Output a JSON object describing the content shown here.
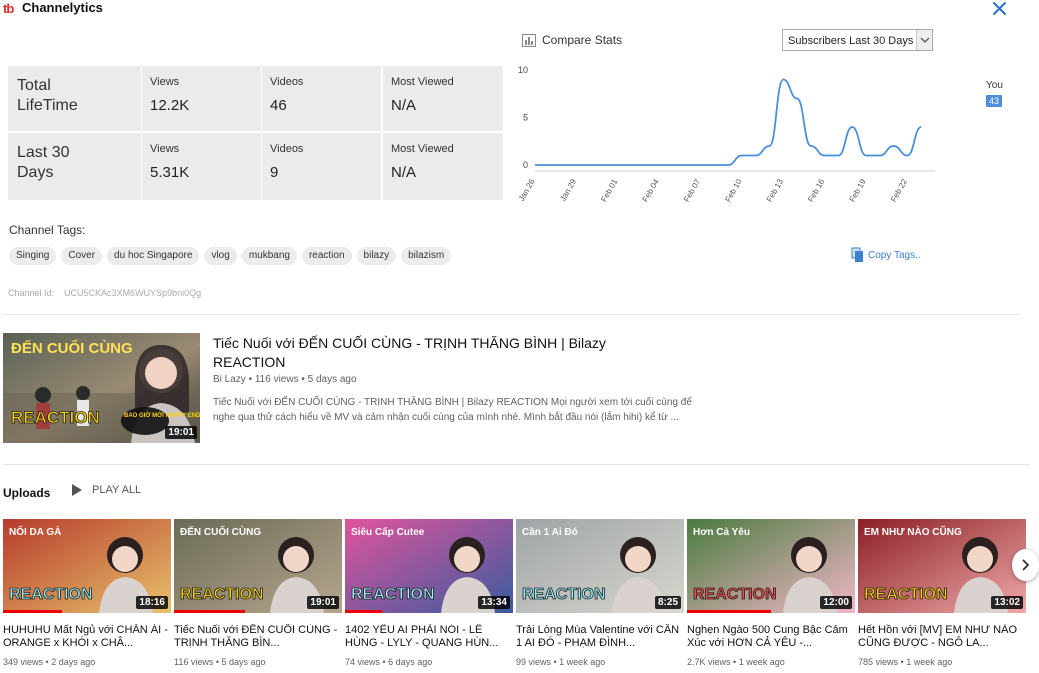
{
  "app": {
    "logo": "tb",
    "title": "Channelytics"
  },
  "stats": {
    "lifetime_label": "Total LifeTime",
    "last30_label": "Last 30 Days",
    "views_label": "Views",
    "videos_label": "Videos",
    "most_viewed_label": "Most Viewed",
    "lifetime": {
      "views": "12.2K",
      "videos": "46",
      "most_viewed": "N/A"
    },
    "last30": {
      "views": "5.31K",
      "videos": "9",
      "most_viewed": "N/A"
    }
  },
  "compare": {
    "title": "Compare Stats",
    "select_value": "Subscribers Last 30 Days",
    "you_label": "You",
    "you_value": "43"
  },
  "chart_data": {
    "type": "line",
    "x": [
      "Jan 26",
      "Jan 27",
      "Jan 28",
      "Jan 29",
      "Jan 30",
      "Jan 31",
      "Feb 01",
      "Feb 02",
      "Feb 03",
      "Feb 04",
      "Feb 05",
      "Feb 06",
      "Feb 07",
      "Feb 08",
      "Feb 09",
      "Feb 10",
      "Feb 11",
      "Feb 12",
      "Feb 13",
      "Feb 14",
      "Feb 15",
      "Feb 16",
      "Feb 17",
      "Feb 18",
      "Feb 19",
      "Feb 20",
      "Feb 21",
      "Feb 22",
      "Feb 23",
      "Feb 24"
    ],
    "series": [
      {
        "name": "You",
        "color": "#4a8fd8",
        "values": [
          0,
          0,
          0,
          0,
          0,
          0,
          0,
          0,
          0,
          0,
          0,
          0,
          0,
          0,
          0,
          1,
          1,
          2,
          9,
          7,
          2,
          1,
          1,
          4,
          1,
          1,
          2,
          1,
          4,
          0
        ]
      }
    ],
    "trimmed_to": "Feb 23",
    "ylim": [
      0,
      10
    ],
    "yticks": [
      0,
      5,
      10
    ],
    "xtick_labels": [
      "Jan 26",
      "Jan 29",
      "Feb 01",
      "Feb 04",
      "Feb 07",
      "Feb 10",
      "Feb 13",
      "Feb 16",
      "Feb 19",
      "Feb 22"
    ],
    "grid": false
  },
  "tags": {
    "title": "Channel Tags:",
    "items": [
      "Singing",
      "Cover",
      "du hoc Singapore",
      "vlog",
      "mukbang",
      "reaction",
      "bilazy",
      "bilazism"
    ],
    "copy_label": "Copy Tags.."
  },
  "channel": {
    "id_label": "Channel Id:",
    "id": "UCU5CKAc3XM6WUYSp9bni0Qg"
  },
  "featured": {
    "title": "Tiếc Nuối với ĐẾN CUỐI CÙNG - TRỊNH THĂNG BÌNH | Bilazy REACTION",
    "meta": "Bi Lazy • 116 views • 5 days ago",
    "description": "Tiếc Nuối với ĐẾN CUỐI CÙNG - TRỊNH THĂNG BÌNH | Bilazy REACTION Mọi người xem tới cuối cùng để nghe qua thử cách hiểu về MV và cảm nhận cuối cùng của mình nhé. Mình bắt đầu nói (lắm hihi) kể từ ...",
    "duration": "19:01",
    "thumb_title": "ĐẾN CUỐI CÙNG",
    "thumb_caption": "BAO GIỜ MỚI HAPPY ENDING ĐƯỢC VẬY???",
    "thumb_word": "REACTION"
  },
  "uploads": {
    "title": "Uploads",
    "play_all": "PLAY ALL",
    "videos": [
      {
        "title": "HUHUHU Mất Ngủ với CHĂN ÁI - ORANGE x KHÓI x CHÂ...",
        "views": "349 views",
        "age": "2 days ago",
        "duration": "18:16",
        "progress": 0.35,
        "bg1": "#b73b2c",
        "bg2": "#e7c16b",
        "word": "REACTION",
        "sub": "NỐI DA GÀ",
        "word_color": "#8ef3ff"
      },
      {
        "title": "Tiếc Nuối với ĐẾN CUỐI CÙNG - TRỊNH THĂNG BÌN...",
        "views": "116 views",
        "age": "5 days ago",
        "duration": "19:01",
        "progress": 0.42,
        "bg1": "#6a6b57",
        "bg2": "#b7a68e",
        "word": "REACTION",
        "sub": "ĐẾN CUỐI CÙNG",
        "word_color": "#ffd400"
      },
      {
        "title": "1402 YÊU AI PHẢI NÓI - LÊ HÙNG - LYLY - QUANG HÙN...",
        "views": "74 views",
        "age": "6 days ago",
        "duration": "13:34",
        "progress": 0.22,
        "bg1": "#e0549d",
        "bg2": "#3a5b9e",
        "word": "REACTION",
        "sub": "Siêu Cấp Cutee",
        "word_color": "#9df7ff"
      },
      {
        "title": "Trải Lòng Mùa Valentine với CẦN 1 AI ĐÓ - PHẠM ĐÌNH...",
        "views": "99 views",
        "age": "1 week ago",
        "duration": "8:25",
        "progress": 0,
        "bg1": "#9ea4a6",
        "bg2": "#d8d7cf",
        "word": "REACTION",
        "sub": "Cần 1 Ai Đó",
        "word_color": "#8ef3ff"
      },
      {
        "title": "Nghẹn Ngào 500 Cung Bậc Cảm Xúc với HƠN CẢ YÊU -...",
        "views": "2.7K views",
        "age": "1 week ago",
        "duration": "12:00",
        "progress": 0.5,
        "bg1": "#4a7b3f",
        "bg2": "#f1b7c8",
        "word": "REACTION",
        "sub": "Hơn Cả Yêu",
        "word_color": "#ff4a4a"
      },
      {
        "title": "Hết Hồn với [MV] EM NHƯ NÀO CŨNG ĐƯỢC - NGÔ LA...",
        "views": "785 views",
        "age": "1 week ago",
        "duration": "13:02",
        "progress": 0,
        "bg1": "#8b1f24",
        "bg2": "#f0a9a9",
        "word": "REACTION",
        "sub": "EM NHƯ NÀO CŨNG",
        "word_color": "#ffd400"
      }
    ]
  }
}
